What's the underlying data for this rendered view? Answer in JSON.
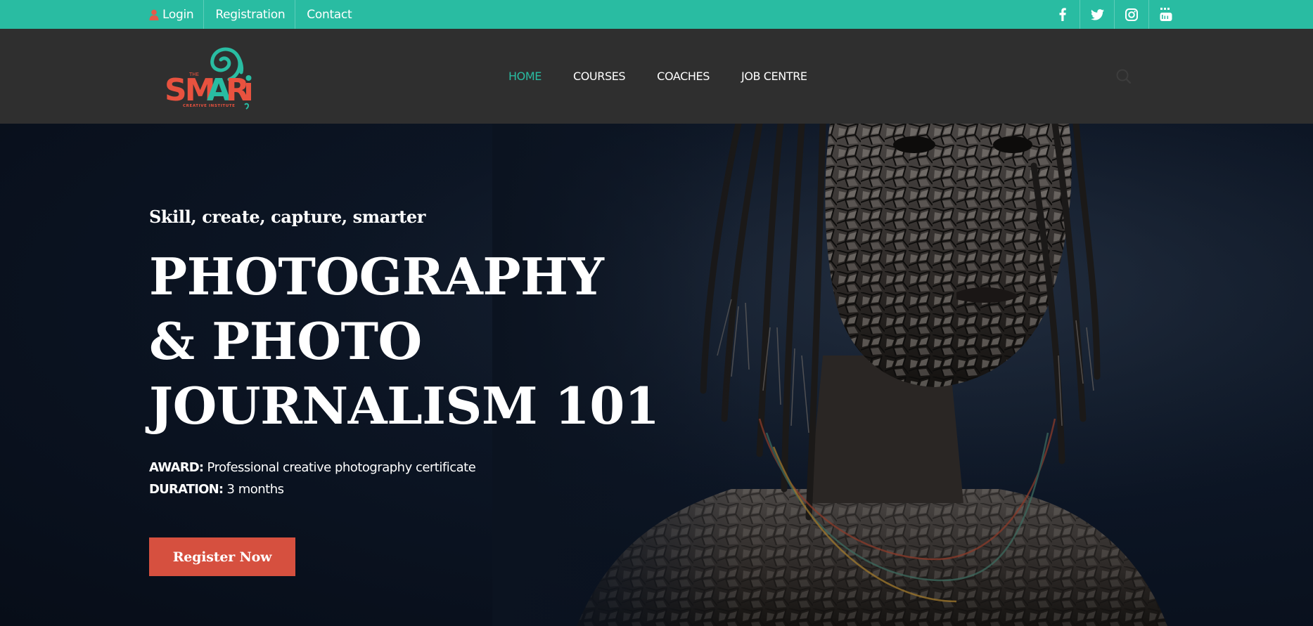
{
  "topbar": {
    "links": [
      "Login",
      "Registration",
      "Contact"
    ],
    "social": [
      "facebook-icon",
      "twitter-icon",
      "instagram-icon",
      "youtube-icon"
    ],
    "bg_color": "#29bca2"
  },
  "logo": {
    "word": "SMARi",
    "small_top": "THE",
    "small_bottom": "CREATIVE INSTITUTE"
  },
  "nav": {
    "items": [
      "HOME",
      "COURSES",
      "COACHES",
      "JOB CENTRE"
    ],
    "active": "HOME"
  },
  "hero": {
    "tagline": "Skill, create, capture, smarter",
    "title_lines": [
      "PHOTOGRAPHY",
      "& PHOTO",
      "JOURNALISM 101"
    ],
    "award_label": "AWARD:",
    "award_value": "Professional creative photography certificate",
    "duration_label": "DURATION:",
    "duration_value": "3 months",
    "cta": "Register Now",
    "cta_color": "#d6503f"
  }
}
